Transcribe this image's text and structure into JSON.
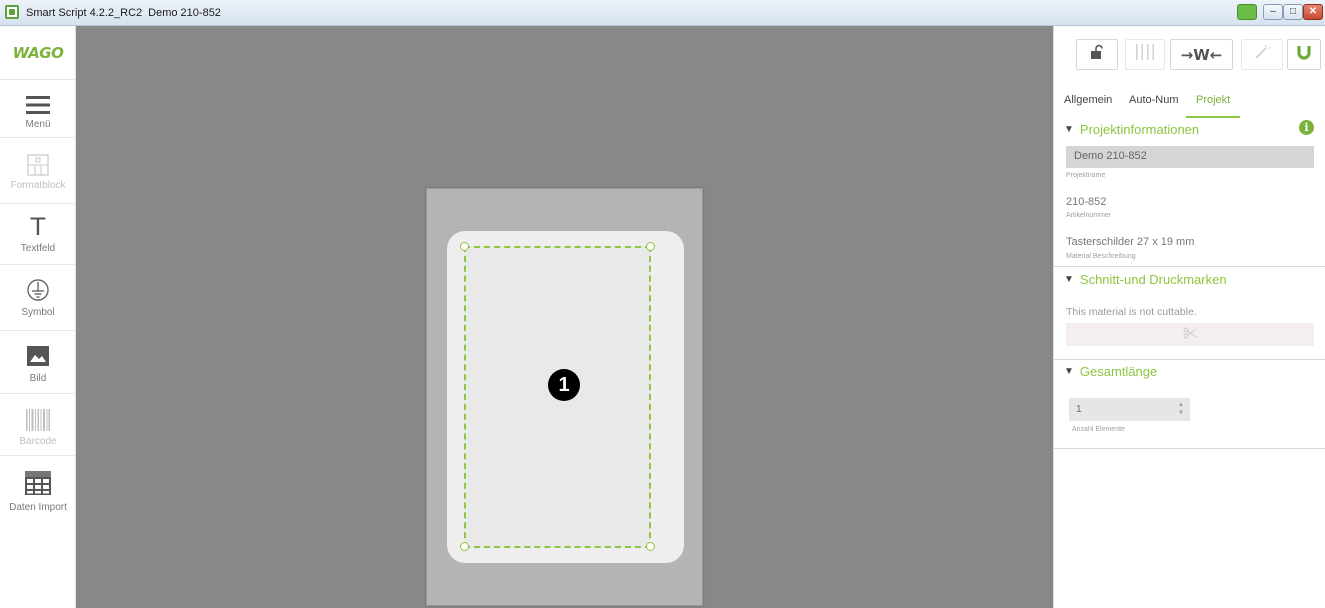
{
  "window": {
    "title": "Smart Script 4.2.2_RC2",
    "project": "Demo 210-852",
    "min_glyph": "–",
    "max_glyph": "□",
    "close_glyph": "✕"
  },
  "logo": {
    "text": "WAGO"
  },
  "toolbar": [
    {
      "label": "Menü",
      "icon": "hamburger-icon",
      "enabled": true
    },
    {
      "label": "Formatblock",
      "icon": "format-block-icon",
      "enabled": false
    },
    {
      "label": "Textfeld",
      "icon": "text-icon",
      "glyph": "T",
      "enabled": true
    },
    {
      "label": "Symbol",
      "icon": "ground-symbol-icon",
      "enabled": true
    },
    {
      "label": "Bild",
      "icon": "image-icon",
      "enabled": true
    },
    {
      "label": "Barcode",
      "icon": "barcode-icon",
      "enabled": false
    },
    {
      "label": "Daten Import",
      "icon": "table-import-icon",
      "enabled": true
    }
  ],
  "canvas": {
    "marker": "1"
  },
  "panel": {
    "tools": {
      "lock_icon": "unlock-icon",
      "columns_icon": "columns-icon",
      "fit_text": "→W←",
      "wand_icon": "magic-wand-icon",
      "magnet_icon": "magnet-icon"
    },
    "tabs": [
      "Allgemein",
      "Auto-Num",
      "Projekt"
    ],
    "active_tab": "Projekt",
    "projectinfo": {
      "heading": "Projektinformationen",
      "project_name": "Demo 210-852",
      "project_name_caption": "Projektname",
      "article_number": "210-852",
      "article_number_caption": "Artikelnummer",
      "material": "Tasterschilder  27 x 19  mm",
      "material_caption": "Material Beschreibung"
    },
    "cutting": {
      "heading": "Schnitt-und Druckmarken",
      "note": "This material is not cuttable.",
      "scissors_icon": "scissors-icon"
    },
    "total": {
      "heading": "Gesamtlänge",
      "value": "1",
      "caption": "Anzahl Elemente"
    }
  },
  "colors": {
    "accent": "#8dc63f",
    "canvas_bg": "#898888",
    "sheet": "#b5b4b5"
  }
}
